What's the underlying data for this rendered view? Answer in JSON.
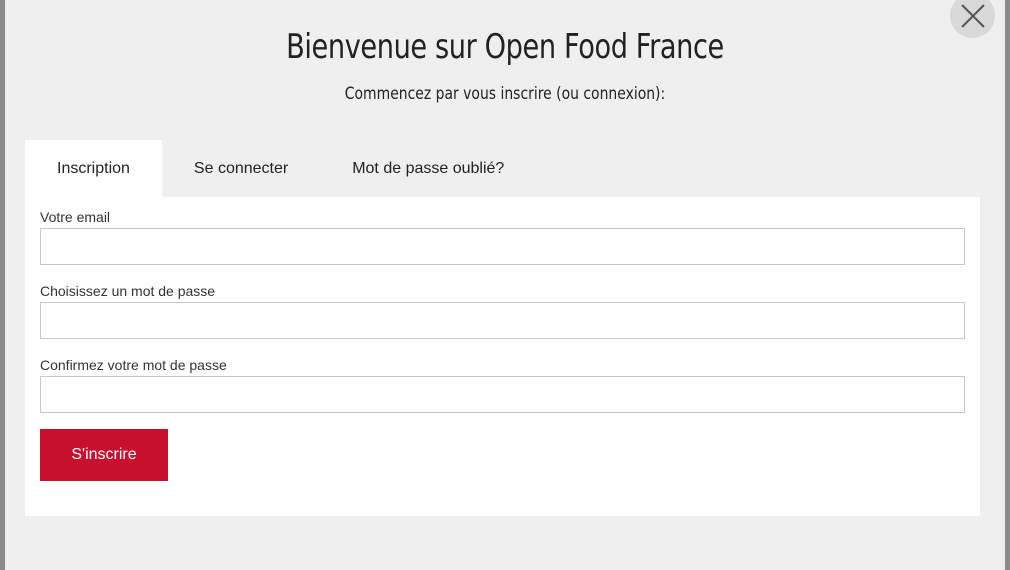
{
  "modal": {
    "title": "Bienvenue sur Open Food France",
    "subtitle": "Commencez par vous inscrire (ou connexion):",
    "close_icon": "close-icon"
  },
  "tabs": [
    {
      "label": "Inscription",
      "active": true
    },
    {
      "label": "Se connecter",
      "active": false
    },
    {
      "label": "Mot de passe oublié?",
      "active": false
    }
  ],
  "form": {
    "email_label": "Votre email",
    "email_value": "",
    "password_label": "Choisissez un mot de passe",
    "password_value": "",
    "confirm_label": "Confirmez votre mot de passe",
    "confirm_value": "",
    "submit_label": "S'inscrire"
  },
  "colors": {
    "accent": "#c8102e",
    "modal_bg": "#efefef",
    "overlay": "#8a8a8a"
  }
}
